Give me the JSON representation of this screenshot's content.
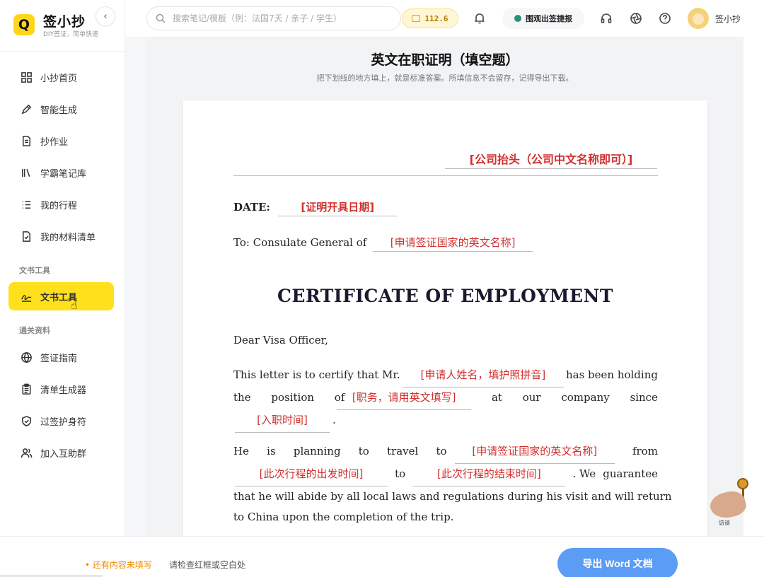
{
  "brand": {
    "name": "签小抄",
    "subtitle": "DIY签证，简单快速",
    "logo_letter": "Q"
  },
  "sidebar": {
    "collapse_icon": "chevron-left-icon",
    "items": [
      {
        "label": "小抄首页",
        "icon": "grid-icon"
      },
      {
        "label": "智能生成",
        "icon": "pen-icon"
      },
      {
        "label": "抄作业",
        "icon": "document-icon"
      },
      {
        "label": "学霸笔记库",
        "icon": "library-icon"
      },
      {
        "label": "我的行程",
        "icon": "list-icon"
      },
      {
        "label": "我的材料清单",
        "icon": "checklist-icon"
      }
    ],
    "section_docs": "文书工具",
    "active_item": {
      "label": "文书工具",
      "icon": "signature-icon"
    },
    "section_clearance": "通关资料",
    "clearance_items": [
      {
        "label": "签证指南",
        "icon": "globe-icon"
      },
      {
        "label": "清单生成器",
        "icon": "clipboard-icon"
      },
      {
        "label": "过签护身符",
        "icon": "shield-icon"
      },
      {
        "label": "加入互助群",
        "icon": "users-icon"
      }
    ]
  },
  "header": {
    "search_placeholder": "搜索笔记/模板（例：法国7天 / 亲子 / 学生）",
    "balance": "112.6",
    "monitor_label": "围观出签捷报",
    "username": "签小抄"
  },
  "main": {
    "title": "英文在职证明（填空题）",
    "subtitle": "把下划线的地方填上，就是标准答案。所填信息不会留存，记得导出下载。"
  },
  "letter": {
    "letterhead": "[公司抬头（公司中文名称即可）]",
    "date_label": "DATE:",
    "date_blank": "[证明开具日期]",
    "to_prefix": "To: Consulate General of",
    "to_blank": "[申请签证国家的英文名称]",
    "cert_title": "CERTIFICATE OF EMPLOYMENT",
    "salutation": "Dear Visa Officer,",
    "p1": {
      "t1": "This letter is to certify that Mr.",
      "name_blank": "[申请人姓名，填护照拼音]",
      "t2": "has been holding",
      "w_the": "the",
      "w_position": "position",
      "w_of": "of",
      "position_blank": "[职务，请用英文填写]",
      "w_at": "at",
      "w_our": "our",
      "w_company": "company",
      "w_since": "since",
      "since_blank": "[入职时间]",
      "t_end": "."
    },
    "p2": {
      "w_he": "He",
      "w_is": "is",
      "w_planning": "planning",
      "w_to": "to",
      "w_travel": "travel",
      "w_to2": "to",
      "country_blank": "[申请签证国家的英文名称]",
      "w_from": "from",
      "depart_blank": "[此次行程的出发时间]",
      "w_to3": "to",
      "return_blank": "[此次行程的结束时间]",
      "w_we": ". We",
      "w_guarantee": "guarantee",
      "line3": "that he will abide by all local laws and regulations during his visit and will return",
      "line4": "to China upon the completion of the trip."
    }
  },
  "float_badge": {
    "label": "访谈",
    "icon": "mascot-icon"
  },
  "footer": {
    "warning": "• 还有内容未填写",
    "hint": "请检查红框或空白处",
    "export_label": "导出 Word 文档"
  },
  "colors": {
    "accent": "#ffe01c",
    "blank_red": "#d32f2f",
    "export_blue": "#5b9cf5",
    "warning_orange": "#f08a00"
  }
}
